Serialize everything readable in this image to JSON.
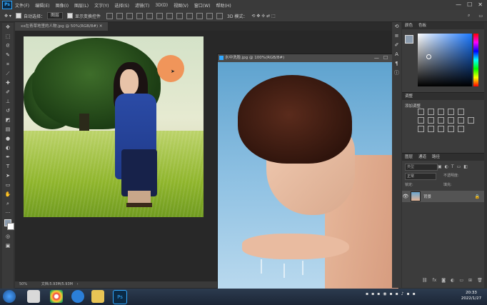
{
  "menu": {
    "logo": "Ps",
    "items": [
      "文件(F)",
      "编辑(E)",
      "图像(I)",
      "图层(L)",
      "文字(Y)",
      "选择(S)",
      "滤镜(T)",
      "3D(D)",
      "视图(V)",
      "窗口(W)",
      "帮助(H)"
    ]
  },
  "options": {
    "auto_select_label": "自动选择：",
    "auto_select_value": "图层",
    "show_transform_label": "显示变换控件",
    "mode_3d_label": "3D 模式："
  },
  "doc1": {
    "tab_title": "xx在青草地里的人物.jpg @ 50%(RGB/8#)",
    "zoom": "50%",
    "doc_size": "文档:5.93M/5.93M"
  },
  "doc2": {
    "title": "水中洗脸.jpg @ 100%(RGB/8#)"
  },
  "panels": {
    "color_tabs": [
      "颜色",
      "色板"
    ],
    "adjust_tab": "调整",
    "adjust_title": "添加调整",
    "layer_tabs": [
      "图层",
      "通道",
      "路径"
    ],
    "search_placeholder": "类型",
    "blend_mode": "正常",
    "opacity_label": "不透明度:",
    "lock_label": "锁定:",
    "fill_label": "填充:",
    "layer_name": "背景"
  },
  "taskbar": {
    "time": "20:33",
    "date": "2022/1/27"
  },
  "colors": {
    "foreground": "#8c9cae",
    "photoshop_blue": "#31a8ff"
  }
}
